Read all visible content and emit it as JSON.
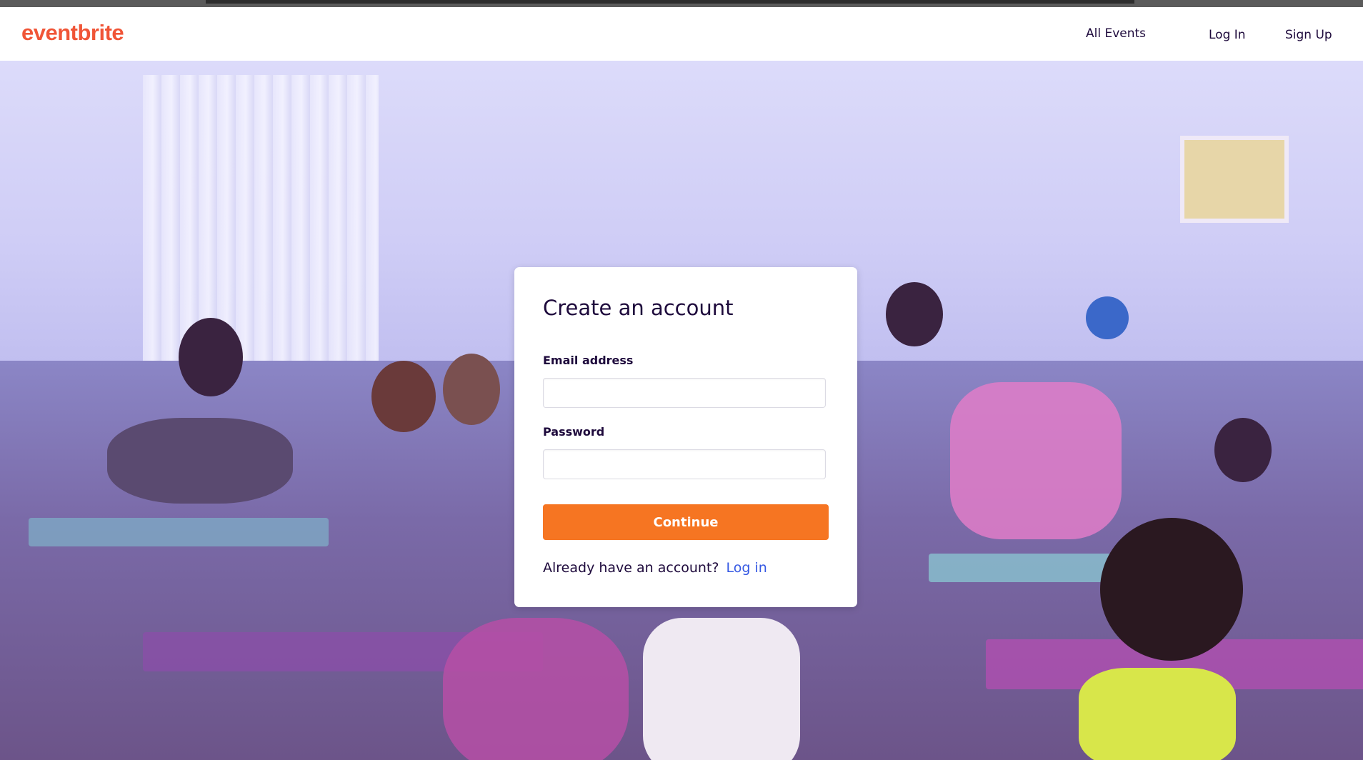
{
  "header": {
    "logo": "eventbrite",
    "nav": {
      "all_events": "All Events",
      "log_in": "Log In",
      "sign_up": "Sign Up"
    }
  },
  "signup_card": {
    "title": "Create an account",
    "email_label": "Email address",
    "email_value": "",
    "password_label": "Password",
    "password_value": "",
    "continue_label": "Continue",
    "already_text": "Already have an account?",
    "login_link": "Log in"
  },
  "colors": {
    "brand": "#f05537",
    "button": "#f67522",
    "link": "#3659e3",
    "text": "#1e0a3c"
  }
}
